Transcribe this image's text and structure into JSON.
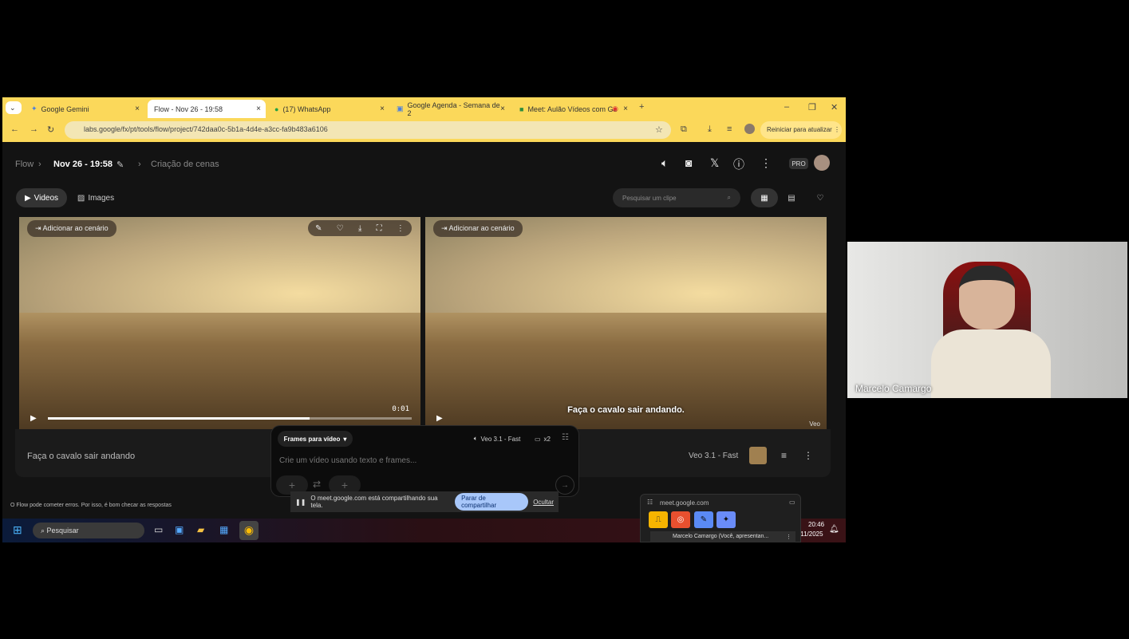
{
  "tabs": [
    {
      "label": "Google Gemini"
    },
    {
      "label": "Flow - Nov 26 - 19:58"
    },
    {
      "label": "(17) WhatsApp"
    },
    {
      "label": "Google Agenda - Semana de 2"
    },
    {
      "label": "Meet: Aulão Vídeos com Ge"
    }
  ],
  "address": {
    "url": "labs.google/fx/pt/tools/flow/project/742daa0c-5b1a-4d4e-a3cc-fa9b483a6106",
    "update_button": "Reiniciar para atualizar"
  },
  "header": {
    "breadcrumb": [
      "Flow",
      "Nov 26 - 19:58",
      "Criação de cenas"
    ],
    "pro_badge": "PRO"
  },
  "toolbar": {
    "tabs": [
      "Videos",
      "Images"
    ],
    "search_placeholder": "Pesquisar um clipe"
  },
  "videos": [
    {
      "add_label": "Adicionar ao cenário",
      "time": "0:01",
      "progress": 0.72
    },
    {
      "add_label": "Adicionar ao cenário",
      "subtitle": "Faça o cavalo sair andando.",
      "watermark": "Veo"
    }
  ],
  "clip": {
    "prompt": "Faça o cavalo sair andando",
    "model": "Veo 3.1 - Fast"
  },
  "composer": {
    "mode": "Frames para vídeo",
    "model": "Veo 3.1 - Fast",
    "count": "x2",
    "placeholder": "Crie um vídeo usando texto e frames..."
  },
  "disclaimer": "O Flow pode cometer erros. Por isso, é bom checar as respostas",
  "share_bar": {
    "message": "O meet.google.com está compartilhando sua tela.",
    "stop": "Parar de compartilhar",
    "hide": "Ocultar"
  },
  "meet_popup": {
    "domain": "meet.google.com",
    "participant": "Marcelo Camargo (Você, apresentan..."
  },
  "taskbar": {
    "search": "Pesquisar",
    "time": "20:46",
    "date": "/11/2025"
  },
  "webcam": {
    "name": "Marcelo Camargo"
  }
}
